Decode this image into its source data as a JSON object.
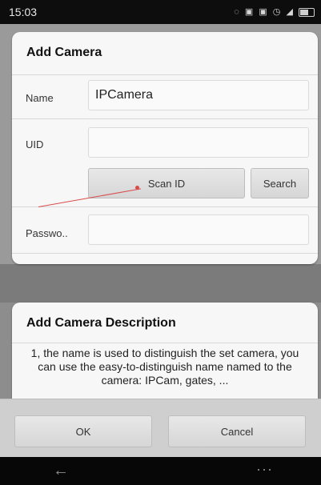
{
  "status_bar": {
    "time": "15:03",
    "icons": [
      "location-icon",
      "sim-icon",
      "sim2-icon",
      "alarm-icon",
      "signal-icon",
      "battery-icon"
    ]
  },
  "add_camera": {
    "title": "Add Camera",
    "fields": {
      "name_label": "Name",
      "name_value": "IPCamera",
      "uid_label": "UID",
      "uid_value": "",
      "password_label": "Passwo..",
      "password_value": ""
    },
    "buttons": {
      "scan_id": "Scan ID",
      "search": "Search"
    }
  },
  "description": {
    "title": "Add Camera Description",
    "text": "1, the name is used to distinguish the set camera, you can use the easy-to-distinguish name named to the camera: IPCam, gates, ..."
  },
  "dialog_buttons": {
    "ok": "OK",
    "cancel": "Cancel"
  },
  "nav_bar": {
    "back": "←",
    "more": "···"
  },
  "colors": {
    "accent_red": "#d94a4a",
    "card_bg": "#f7f7f7"
  }
}
